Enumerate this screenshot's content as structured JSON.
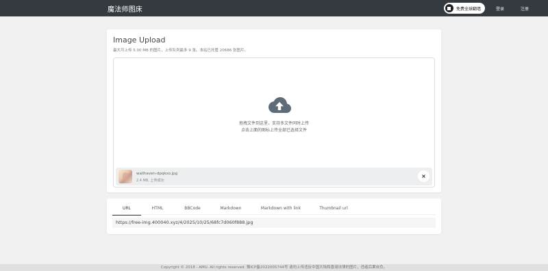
{
  "navbar": {
    "brand": "魔法师图床",
    "pill_label": "免费全球翻墙",
    "login": "登录",
    "register": "注册"
  },
  "upload": {
    "title": "Image Upload",
    "description": "最大可上传 5.00 MB 的图片，上传队列最多 9 张。本站已托管 20686 张图片。",
    "drop_line1": "拖拽文件到这里，支持多文件同时上传",
    "drop_line2": "点击上面的图标上传全部已选择文件",
    "cloud_icon": "cloud-upload-icon",
    "file": {
      "name": "wallhaven-dpqkxo.jpg",
      "meta": "2.4 MB, 上传成功",
      "close": "×"
    }
  },
  "links": {
    "tabs": [
      "URL",
      "HTML",
      "BBCode",
      "Markdown",
      "Markdown with link",
      "Thumbnail url"
    ],
    "active_tab": "URL",
    "url_value": "https://free-img.400040.xyz/4/2025/10/25/68fc7d060f888.jpg"
  },
  "footer": {
    "text": "Copyright © 2018 - AMU. All rights reserved.   豫ICP备2022005744号  请勿上传违反中国大陆和香港法律的图片，违者后果自负。"
  },
  "colors": {
    "navbar_bg": "#343a40",
    "page_bg": "#f1f1f1",
    "card_bg": "#ffffff",
    "file_item_bg": "#eceeef"
  }
}
